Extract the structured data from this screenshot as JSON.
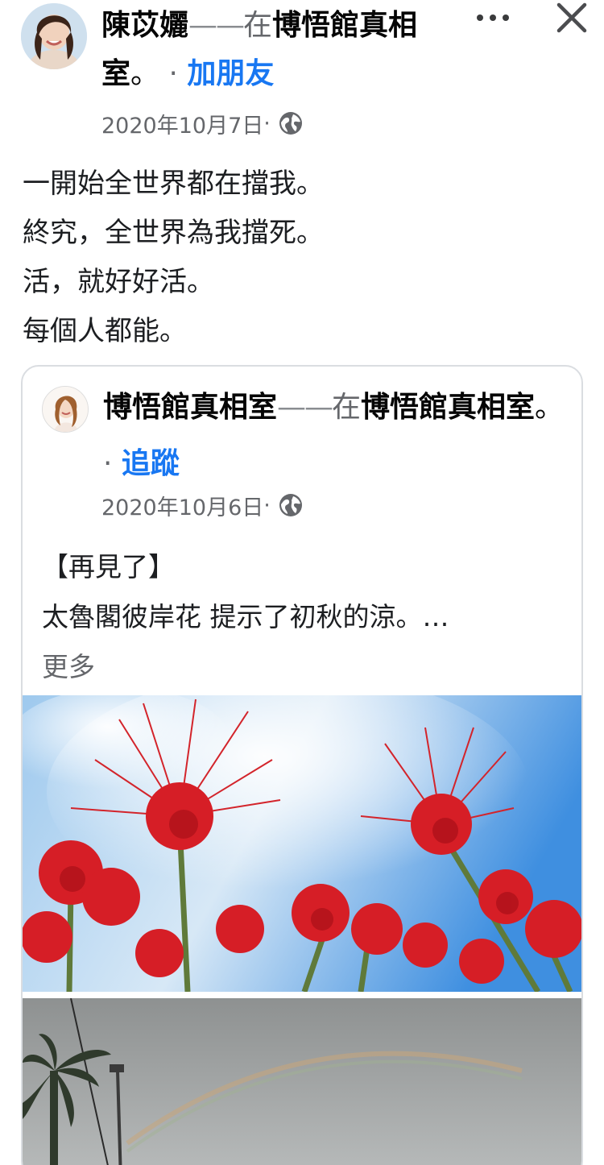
{
  "post": {
    "author": "陳苡孋",
    "dash": "——",
    "at": "在",
    "place": "博悟館真相室",
    "period": "。",
    "separator": " · ",
    "action": "加朋友",
    "date": "2020年10月7日",
    "date_sep": " · ",
    "privacy_icon": "globe-icon",
    "body_lines": [
      "一開始全世界都在擋我。",
      "終究，全世界為我擋死。",
      "活，就好好活。",
      "每個人都能。"
    ]
  },
  "shared": {
    "author": "博悟館真相室",
    "dash": "——",
    "at": "在",
    "place": "博悟館真相室",
    "period": "。",
    "separator": " · ",
    "action": "追蹤",
    "date": "2020年10月6日",
    "date_sep": " · ",
    "privacy_icon": "globe-icon",
    "body_lines": [
      "【再見了】",
      "太魯閣彼岸花 提示了初秋的涼。…"
    ],
    "see_more": "更多"
  },
  "icons": {
    "more": "more-options-icon",
    "close": "close-icon"
  },
  "colors": {
    "link": "#1877f2",
    "secondary_text": "#65676b",
    "card_border": "#dadde1"
  }
}
